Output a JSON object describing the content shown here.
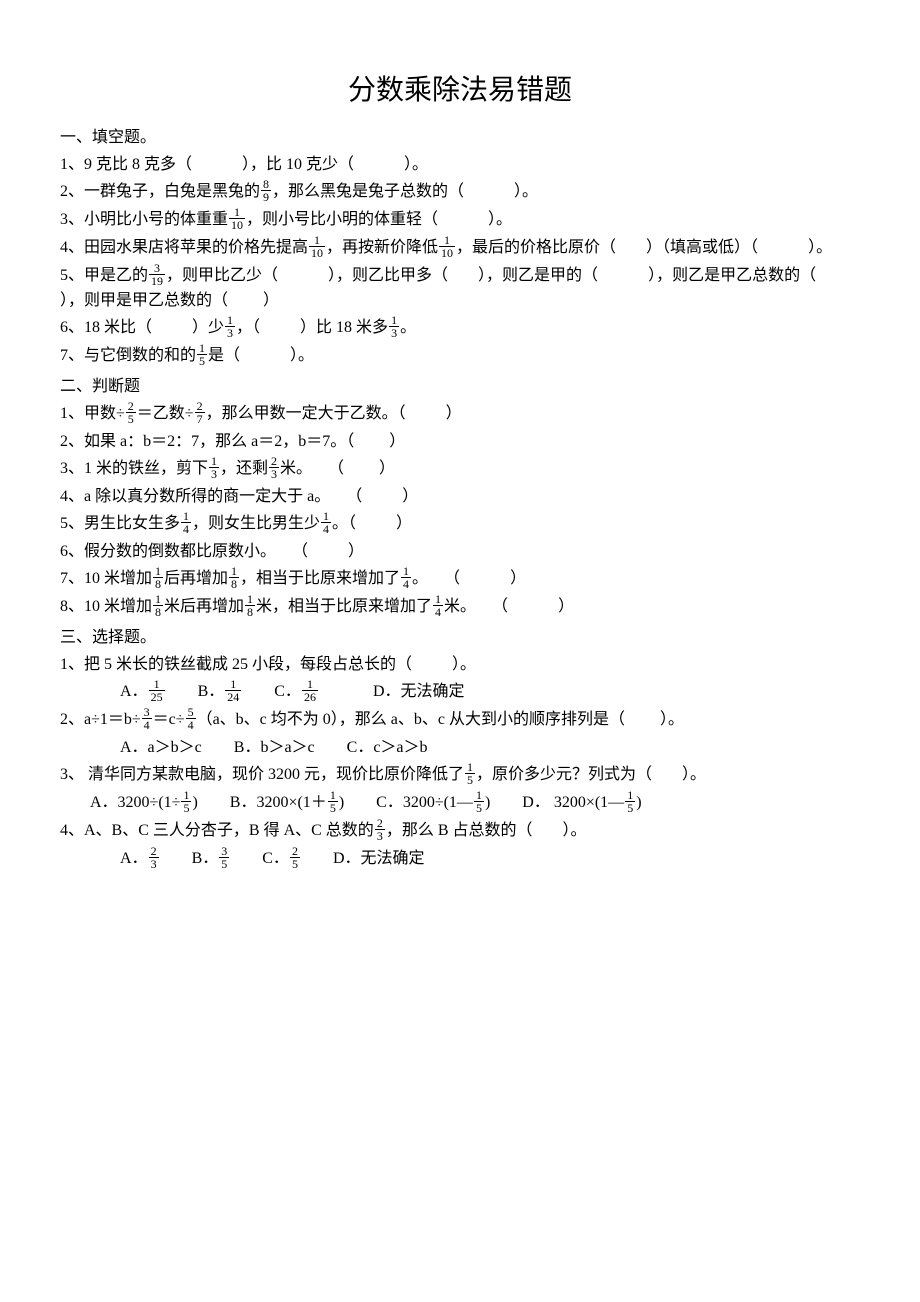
{
  "title": "分数乘除法易错题",
  "s1": {
    "heading": "一、填空题。",
    "q1": {
      "a": "1、9 克比 8 克多（",
      "b": "），比 10 克少（",
      "c": "）。"
    },
    "q2": {
      "a": "2、一群兔子，白兔是黑兔的",
      "f": {
        "n": "8",
        "d": "9"
      },
      "b": "，那么黑兔是兔子总数的（",
      "c": "）。"
    },
    "q3": {
      "a": "3、小明比小号的体重重",
      "f": {
        "n": "1",
        "d": "10"
      },
      "b": "，则小号比小明的体重轻（",
      "c": "）。"
    },
    "q4": {
      "a": "4、田园水果店将苹果的价格先提高",
      "f1": {
        "n": "1",
        "d": "10"
      },
      "b": "，再按新价降低",
      "f2": {
        "n": "1",
        "d": "10"
      },
      "c": "，最后的价格比原价（",
      "d": "）（填高或低）（",
      "e": "）。"
    },
    "q5": {
      "a": "5、甲是乙的",
      "f": {
        "n": "3",
        "d": "19"
      },
      "b": "，则甲比乙少（",
      "c": "），则乙比甲多（",
      "d": "），则乙是甲的（",
      "e": "），则乙是甲乙总数的（",
      "g": "），则甲是甲乙总数的（",
      "h": "）"
    },
    "q6": {
      "a": "6、18 米比（",
      "b": "）少",
      "f1": {
        "n": "1",
        "d": "3"
      },
      "c": "，（",
      "d": "）比 18 米多",
      "f2": {
        "n": "1",
        "d": "3"
      },
      "e": "。"
    },
    "q7": {
      "a": "7、与它倒数的和的",
      "f": {
        "n": "1",
        "d": "5"
      },
      "b": "是（",
      "c": "）。"
    }
  },
  "s2": {
    "heading": "二、判断题",
    "q1": {
      "a": "1、甲数÷",
      "f1": {
        "n": "2",
        "d": "5"
      },
      "b": "＝乙数÷",
      "f2": {
        "n": "2",
        "d": "7"
      },
      "c": "，那么甲数一定大于乙数。（",
      "d": "）"
    },
    "q2": {
      "a": "2、如果 a：b＝2：7，那么 a＝2，b＝7。（",
      "b": "）"
    },
    "q3": {
      "a": "3、1 米的铁丝，剪下",
      "f1": {
        "n": "1",
        "d": "3"
      },
      "b": "，还剩",
      "f2": {
        "n": "2",
        "d": "3"
      },
      "c": "米。　　（",
      "d": "）"
    },
    "q4": {
      "a": "4、a 除以真分数所得的商一定大于 a。　　（",
      "b": "）"
    },
    "q5": {
      "a": "5、男生比女生多",
      "f1": {
        "n": "1",
        "d": "4"
      },
      "b": "，则女生比男生少",
      "f2": {
        "n": "1",
        "d": "4"
      },
      "c": "。（",
      "d": "）"
    },
    "q6": {
      "a": "6、假分数的倒数都比原数小。　　（",
      "b": "）"
    },
    "q7": {
      "a": "7、10 米增加",
      "f1": {
        "n": "1",
        "d": "8"
      },
      "b": "后再增加",
      "f2": {
        "n": "1",
        "d": "8"
      },
      "c": "，相当于比原来增加了",
      "f3": {
        "n": "1",
        "d": "4"
      },
      "d": "。　　（",
      "e": "）"
    },
    "q8": {
      "a": "8、10 米增加",
      "f1": {
        "n": "1",
        "d": "8"
      },
      "b": "米后再增加",
      "f2": {
        "n": "1",
        "d": "8"
      },
      "c": "米，相当于比原来增加了",
      "f3": {
        "n": "1",
        "d": "4"
      },
      "d": "米。　　（",
      "e": "）"
    }
  },
  "s3": {
    "heading": "三、选择题。",
    "q1": {
      "a": "1、把 5 米长的铁丝截成 25 小段，每段占总长的（",
      "b": "）。",
      "optA": "A．",
      "fA": {
        "n": "1",
        "d": "25"
      },
      "optB": "B．",
      "fB": {
        "n": "1",
        "d": "24"
      },
      "optC": "C．",
      "fC": {
        "n": "1",
        "d": "26"
      },
      "optD": "D．无法确定"
    },
    "q2": {
      "a": "2、a÷1＝b÷",
      "f1": {
        "n": "3",
        "d": "4"
      },
      "b": "＝c÷",
      "f2": {
        "n": "5",
        "d": "4"
      },
      "c": "（a、b、c 均不为 0），那么 a、b、c 从大到小的顺序排列是（",
      "d": "）。",
      "optA": "A．a＞b＞c",
      "optB": "B．b＞a＞c",
      "optC": "C．c＞a＞b"
    },
    "q3": {
      "a": "3、 清华同方某款电脑，现价 3200 元，现价比原价降低了",
      "f": {
        "n": "1",
        "d": "5"
      },
      "b": "，原价多少元？列式为（",
      "c": "）。",
      "optA": "A．3200÷(1÷",
      "fA": {
        "n": "1",
        "d": "5"
      },
      "optAend": ")",
      "optB": "B．3200×(1＋",
      "fB": {
        "n": "1",
        "d": "5"
      },
      "optBend": ")",
      "optC": "C．3200÷(1—",
      "fC": {
        "n": "1",
        "d": "5"
      },
      "optCend": ")",
      "optD": "D．  3200×(1—",
      "fD": {
        "n": "1",
        "d": "5"
      },
      "optDend": ")"
    },
    "q4": {
      "a": "4、A、B、C 三人分杏子，B 得 A、C 总数的",
      "f": {
        "n": "2",
        "d": "3"
      },
      "b": "，那么 B 占总数的（",
      "c": "）。",
      "optA": "A．",
      "fA": {
        "n": "2",
        "d": "3"
      },
      "optB": "B．",
      "fB": {
        "n": "3",
        "d": "5"
      },
      "optC": "C．",
      "fC": {
        "n": "2",
        "d": "5"
      },
      "optD": "D．无法确定"
    }
  }
}
